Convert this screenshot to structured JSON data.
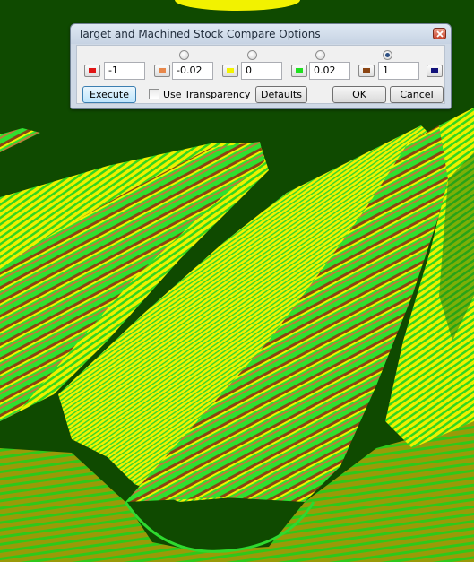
{
  "dialog": {
    "title": "Target and Machined Stock Compare Options",
    "close_icon": "close-x-icon",
    "thresholds": [
      {
        "color_label": "red",
        "color": "#e11515",
        "value": "-1"
      },
      {
        "color_label": "orange",
        "color": "#e8874a",
        "value": "-0.02"
      },
      {
        "color_label": "yellow",
        "color": "#f4f400",
        "value": "0"
      },
      {
        "color_label": "green",
        "color": "#1fe01f",
        "value": "0.02"
      },
      {
        "color_label": "brown",
        "color": "#8a4412",
        "value": "1"
      },
      {
        "color_label": "navy",
        "color": "#12127a",
        "value": ""
      }
    ],
    "selected_radio_index": 3,
    "buttons": {
      "execute": "Execute",
      "defaults": "Defaults",
      "ok": "OK",
      "cancel": "Cancel"
    },
    "use_transparency": {
      "label": "Use Transparency",
      "checked": false
    }
  },
  "scene": {
    "background": "#0f4a00",
    "colors": {
      "yellow": "#f2f200",
      "green": "#2fd92f",
      "olive": "#8c8c00",
      "brown": "#8a4412",
      "dark_green": "#1a7a00"
    }
  }
}
